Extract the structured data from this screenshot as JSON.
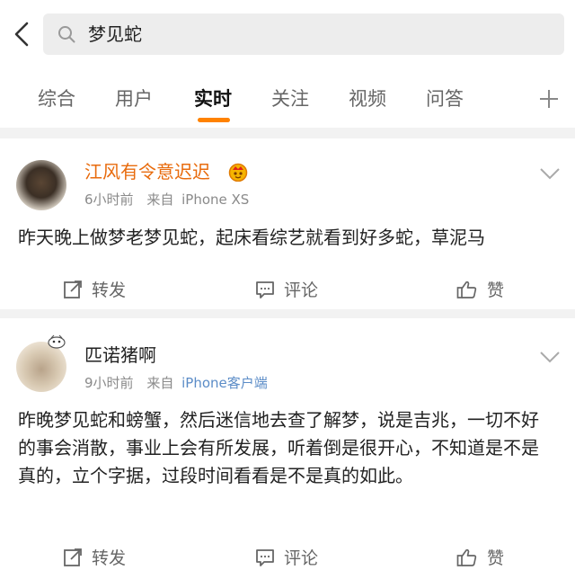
{
  "header": {
    "search_query": "梦见蛇"
  },
  "tabs": [
    {
      "label": "综合"
    },
    {
      "label": "用户"
    },
    {
      "label": "实时",
      "active": true
    },
    {
      "label": "关注"
    },
    {
      "label": "视频"
    },
    {
      "label": "问答"
    }
  ],
  "colors": {
    "accent": "#ff8200",
    "vip_name": "#e86b0d",
    "source_link": "#5b8cc7"
  },
  "posts": [
    {
      "username": "江风有令意迟迟",
      "time": "6小时前",
      "source_prefix": "来自",
      "source": "iPhone XS",
      "text": "昨天晚上做梦老梦见蛇，起床看综艺就看到好多蛇，草泥马",
      "actions": {
        "repost": "转发",
        "comment": "评论",
        "like": "赞"
      }
    },
    {
      "username": "匹诺猪啊",
      "time": "9小时前",
      "source_prefix": "来自",
      "source": "iPhone客户端",
      "text": "昨晚梦见蛇和螃蟹，然后迷信地去查了解梦，说是吉兆，一切不好的事会消散，事业上会有所发展，听着倒是很开心，不知道是不是真的，立个字据，过段时间看看是不是真的如此。",
      "actions": {
        "repost": "转发",
        "comment": "评论",
        "like": "赞"
      }
    }
  ]
}
